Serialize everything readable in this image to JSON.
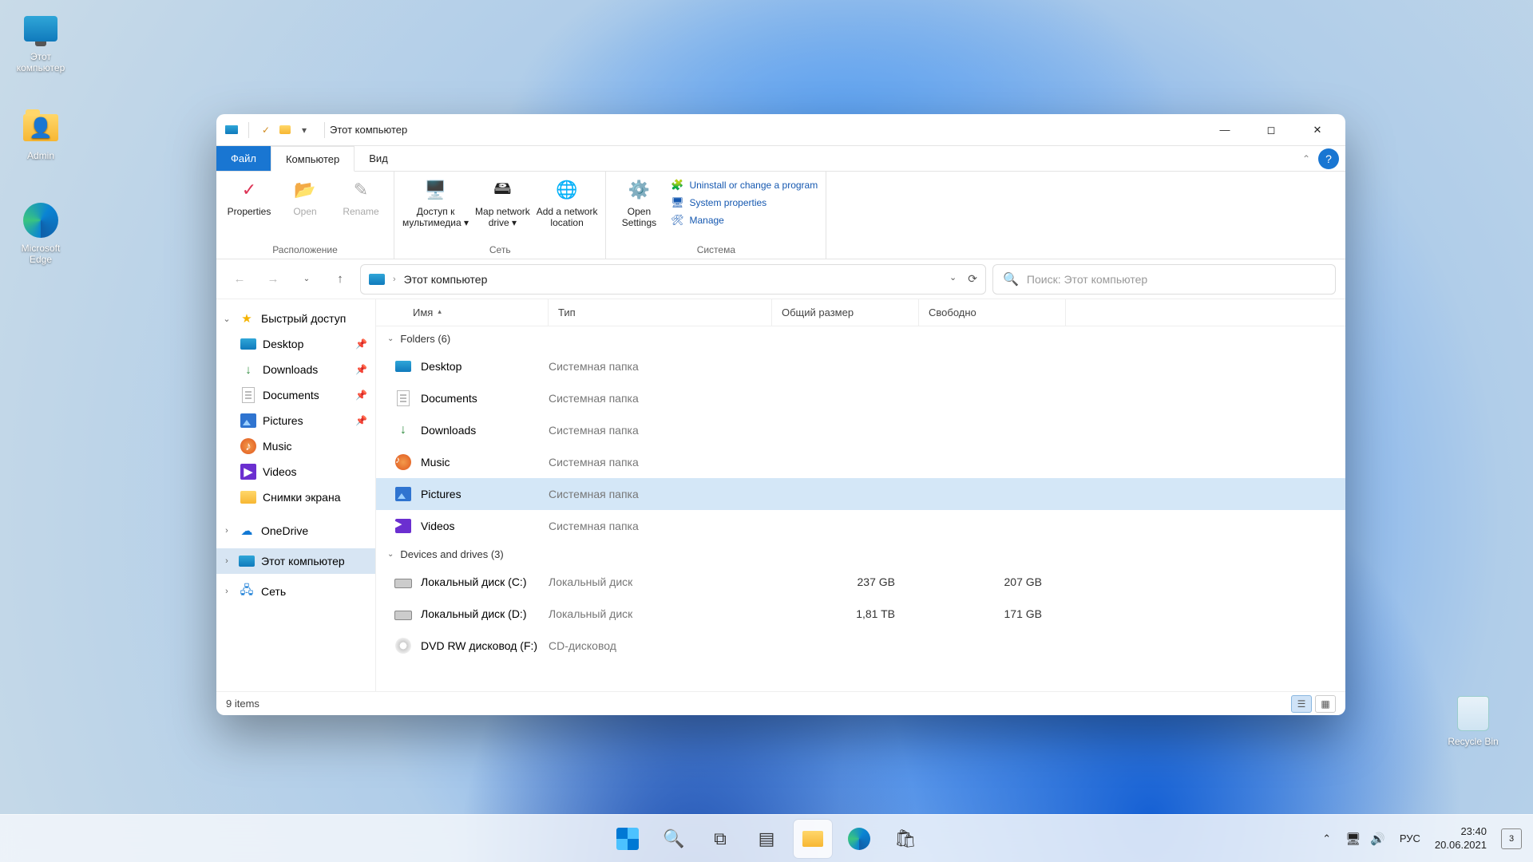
{
  "desktop": {
    "this_pc": "Этот\nкомпьютер",
    "admin": "Admin",
    "edge": "Microsoft\nEdge",
    "recycle": "Recycle Bin"
  },
  "titlebar": {
    "title": "Этот компьютер"
  },
  "tabs": {
    "file": "Файл",
    "computer": "Компьютер",
    "view": "Вид"
  },
  "ribbon": {
    "group_location": "Расположение",
    "group_network": "Сеть",
    "group_system": "Система",
    "properties": "Properties",
    "open": "Open",
    "rename": "Rename",
    "media": "Доступ к\nмультимедиа ▾",
    "map": "Map network\ndrive ▾",
    "addnet": "Add a network\nlocation",
    "settings": "Open\nSettings",
    "uninstall": "Uninstall or change a program",
    "sysprop": "System properties",
    "manage": "Manage"
  },
  "nav": {
    "path": "Этот компьютер",
    "search_ph": "Поиск: Этот компьютер"
  },
  "sidebar": {
    "quick": "Быстрый доступ",
    "desktop": "Desktop",
    "downloads": "Downloads",
    "documents": "Documents",
    "pictures": "Pictures",
    "music": "Music",
    "videos": "Videos",
    "screenshots": "Снимки экрана",
    "onedrive": "OneDrive",
    "this_pc": "Этот компьютер",
    "network": "Сеть"
  },
  "columns": {
    "name": "Имя",
    "type": "Тип",
    "total": "Общий размер",
    "free": "Свободно"
  },
  "groups": {
    "folders": "Folders (6)",
    "drives": "Devices and drives (3)"
  },
  "folders": [
    {
      "name": "Desktop",
      "type": "Системная папка",
      "icon": "desktop"
    },
    {
      "name": "Documents",
      "type": "Системная папка",
      "icon": "doc"
    },
    {
      "name": "Downloads",
      "type": "Системная папка",
      "icon": "down"
    },
    {
      "name": "Music",
      "type": "Системная папка",
      "icon": "music"
    },
    {
      "name": "Pictures",
      "type": "Системная папка",
      "icon": "pic",
      "selected": true
    },
    {
      "name": "Videos",
      "type": "Системная папка",
      "icon": "vid"
    }
  ],
  "drives": [
    {
      "name": "Локальный диск (C:)",
      "type": "Локальный диск",
      "total": "237 GB",
      "free": "207 GB",
      "icon": "drive"
    },
    {
      "name": "Локальный диск (D:)",
      "type": "Локальный диск",
      "total": "1,81 TB",
      "free": "171 GB",
      "icon": "drive"
    },
    {
      "name": "DVD RW дисковод (F:)",
      "type": "CD-дисковод",
      "total": "",
      "free": "",
      "icon": "dvd"
    }
  ],
  "status": {
    "items": "9 items"
  },
  "tray": {
    "lang": "РУС",
    "time": "23:40",
    "date": "20.06.2021",
    "notif": "3"
  }
}
